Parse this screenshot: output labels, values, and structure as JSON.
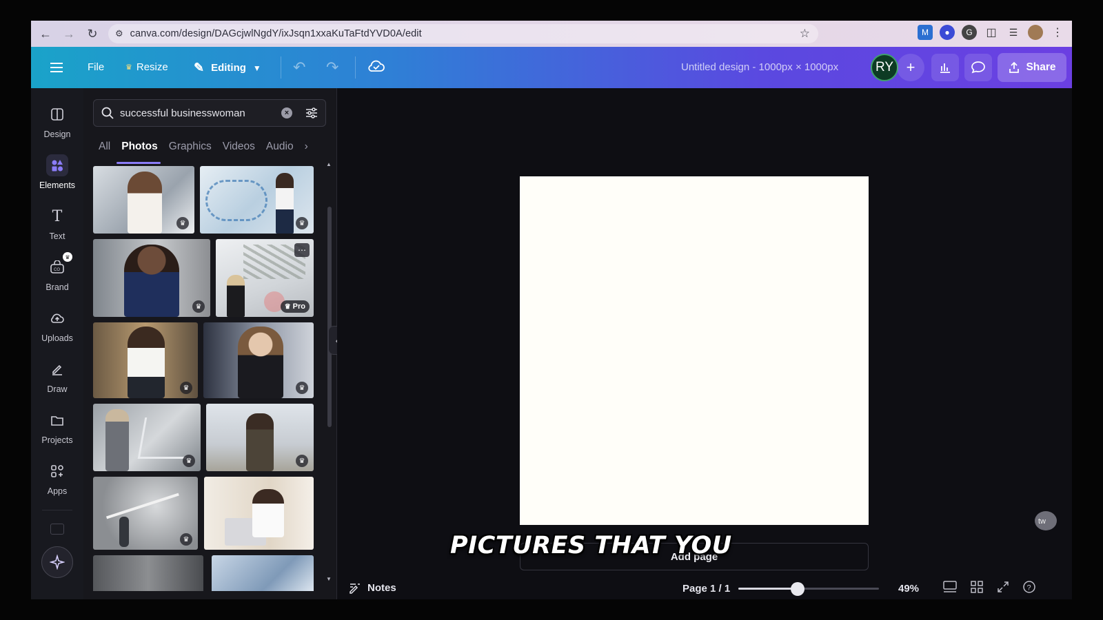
{
  "browser": {
    "url": "canva.com/design/DAGcjwlNgdY/ixJsqn1xxaKuTaFtdYVD0A/edit"
  },
  "toolbar": {
    "file_label": "File",
    "resize_label": "Resize",
    "editing_label": "Editing",
    "design_title": "Untitled design - 1000px × 1000px",
    "avatar_initials": "RY",
    "share_label": "Share"
  },
  "rail": {
    "items": [
      {
        "label": "Design",
        "icon": "design-icon"
      },
      {
        "label": "Elements",
        "icon": "elements-icon"
      },
      {
        "label": "Text",
        "icon": "text-icon"
      },
      {
        "label": "Brand",
        "icon": "brand-icon"
      },
      {
        "label": "Uploads",
        "icon": "upload-icon"
      },
      {
        "label": "Draw",
        "icon": "draw-icon"
      },
      {
        "label": "Projects",
        "icon": "folder-icon"
      },
      {
        "label": "Apps",
        "icon": "apps-icon"
      }
    ]
  },
  "panel": {
    "search_value": "successful businesswoman",
    "tabs": [
      "All",
      "Photos",
      "Graphics",
      "Videos",
      "Audio"
    ],
    "active_tab": "Photos",
    "pro_label": "Pro"
  },
  "canvas": {
    "add_page_label": "Add page"
  },
  "bottombar": {
    "notes_label": "Notes",
    "page_label": "Page 1 / 1",
    "zoom_label": "49%",
    "zoom_fraction": 0.42
  },
  "overlay": {
    "subtitle": "PICTURES THAT YOU"
  },
  "colors": {
    "toolbar_gradient_start": "#1aa3c9",
    "toolbar_gradient_end": "#6b3fe2",
    "accent": "#8b7cf7",
    "panel_bg": "#17171c"
  }
}
